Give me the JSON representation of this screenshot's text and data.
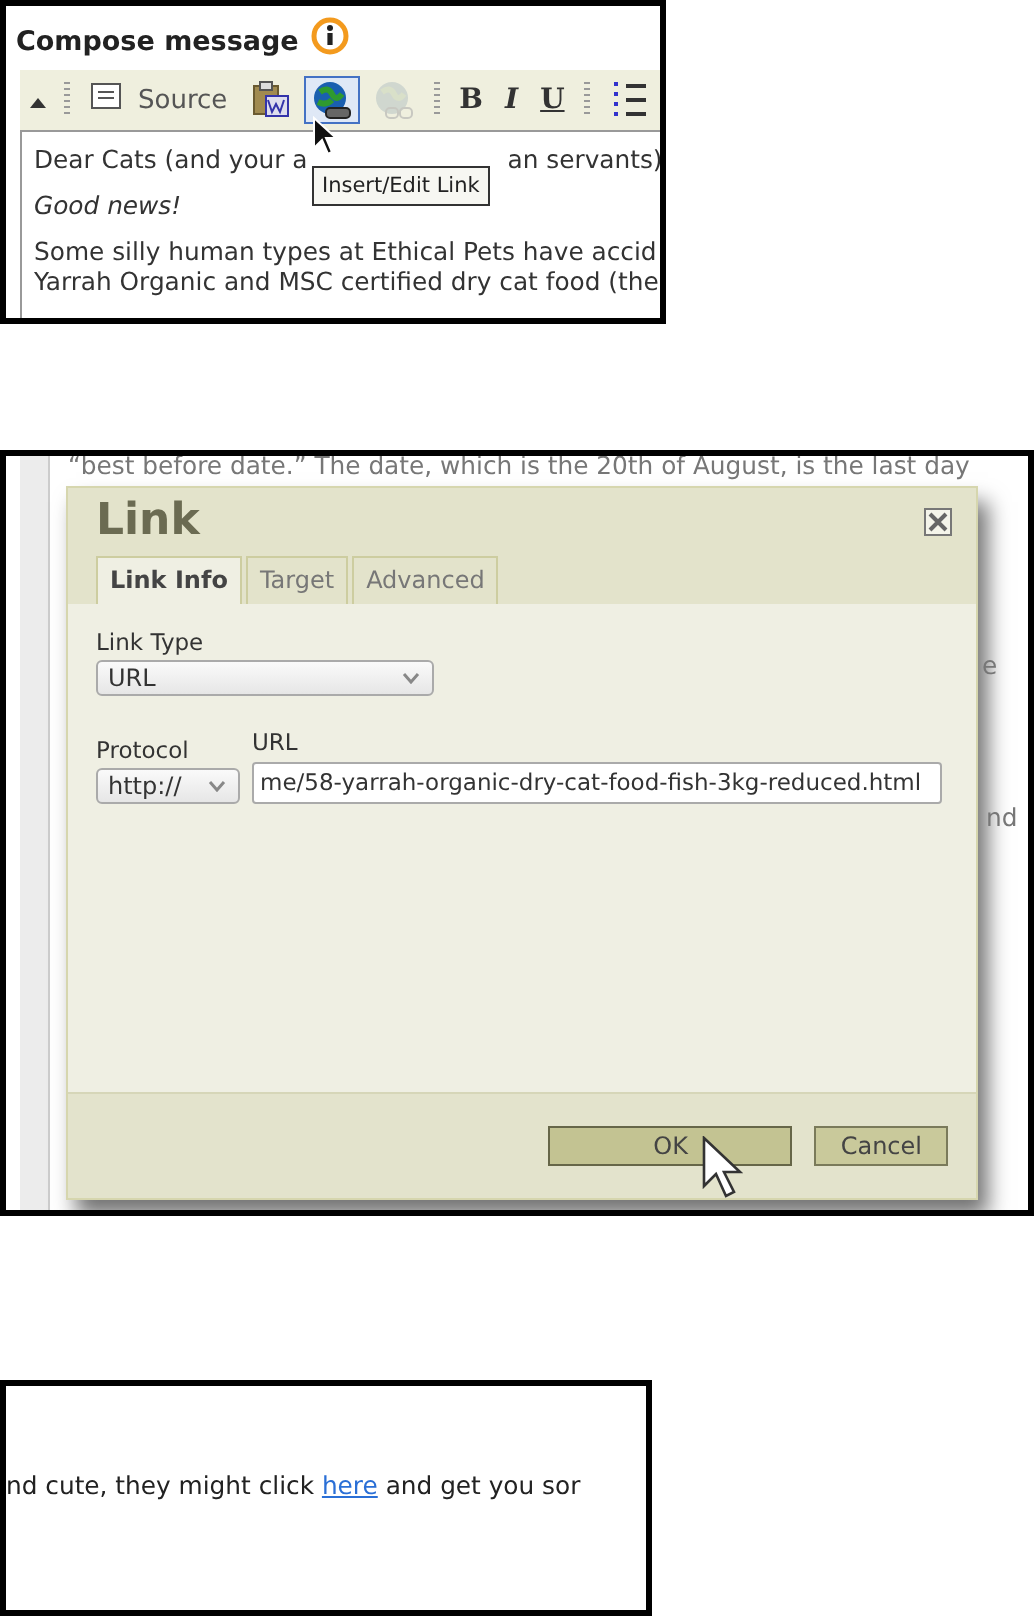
{
  "compose": {
    "title": "Compose message",
    "toolbar": [
      {
        "kind": "source",
        "label": "Source",
        "selected": false,
        "disabled": false
      },
      {
        "kind": "paste-word",
        "selected": false,
        "disabled": false
      },
      {
        "kind": "link",
        "selected": true,
        "disabled": false
      },
      {
        "kind": "unlink",
        "selected": false,
        "disabled": true
      },
      {
        "kind": "separator"
      },
      {
        "kind": "bold",
        "label": "B",
        "selected": false,
        "disabled": false
      },
      {
        "kind": "italic",
        "label": "I",
        "selected": false,
        "disabled": false
      },
      {
        "kind": "underline",
        "label": "U",
        "selected": false,
        "disabled": false
      },
      {
        "kind": "separator"
      },
      {
        "kind": "list",
        "selected": false,
        "disabled": false
      }
    ],
    "tooltip": "Insert/Edit Link",
    "paragraphs": [
      {
        "lines": [
          [
            "Dear Cats (and your a",
            "an servants)"
          ]
        ],
        "italic": false
      },
      {
        "lines": [
          [
            "Good news!"
          ]
        ],
        "italic": true
      },
      {
        "lines": [
          [
            "Some silly human types at Ethical Pets have accid"
          ],
          [
            "Yarrah Organic and MSC certified dry cat food (the"
          ]
        ],
        "italic": false
      }
    ]
  },
  "link_dialog": {
    "background_lines": [
      "“best before date.” The date, which is the 20th of August, is the last day"
    ],
    "background_fragments": [
      "e",
      "nd"
    ],
    "title": "Link",
    "tabs": [
      {
        "label": "Link Info",
        "selected": true
      },
      {
        "label": "Target",
        "selected": false
      },
      {
        "label": "Advanced",
        "selected": false
      }
    ],
    "link_type": {
      "label": "Link Type",
      "value": "URL"
    },
    "protocol": {
      "label": "Protocol",
      "value": "http://"
    },
    "url": {
      "label": "URL",
      "value": "me/58-yarrah-organic-dry-cat-food-fish-3kg-reduced.html"
    },
    "buttons": [
      {
        "label": "OK",
        "hovered": true
      },
      {
        "label": "Cancel",
        "hovered": false
      }
    ]
  },
  "result": {
    "before": "nd cute, they might click ",
    "link": "here",
    "after": " and get you sor"
  }
}
